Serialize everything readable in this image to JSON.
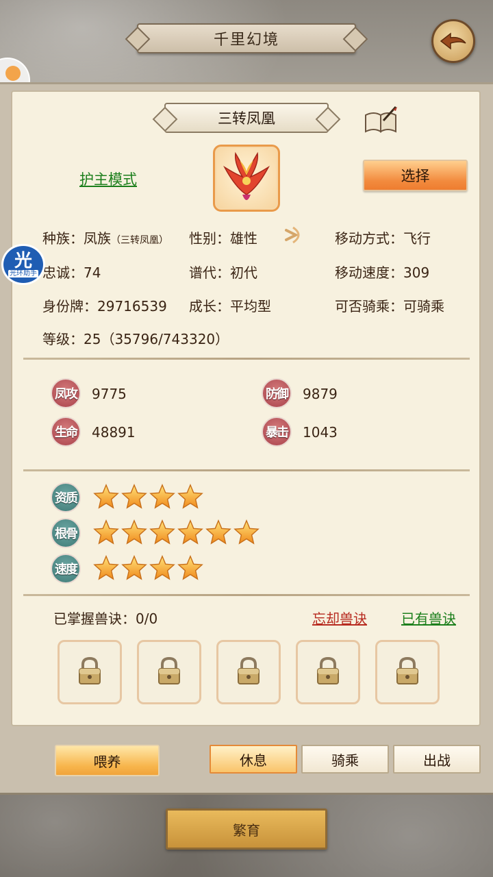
{
  "header": {
    "title": "千里幻境"
  },
  "helper": {
    "glyph": "光",
    "label": "光环助手"
  },
  "pet": {
    "name": "三转凤凰",
    "guard_mode_label": "护主模式",
    "select_label": "选择",
    "race": "种族：凤族",
    "race_detail": "（三转凤凰）",
    "gender": "性别：雄性",
    "movement_type": "移动方式：飞行",
    "loyalty": "忠诚：74",
    "generation": "谱代：初代",
    "movement_speed": "移动速度：309",
    "id_tag": "身份牌：29716539",
    "growth": "成长：平均型",
    "rideable": "可否骑乘：可骑乘",
    "level": "等级：25（35796/743320）"
  },
  "stats": {
    "attack": {
      "label": "凤攻",
      "value": "9775"
    },
    "defense": {
      "label": "防御",
      "value": "9879"
    },
    "hp": {
      "label": "生命",
      "value": "48891"
    },
    "crit": {
      "label": "暴击",
      "value": "1043"
    }
  },
  "ratings": {
    "aptitude": {
      "label": "资质",
      "stars": 4
    },
    "bone": {
      "label": "根骨",
      "stars": 6
    },
    "speed": {
      "label": "速度",
      "stars": 4
    }
  },
  "skills": {
    "mastered": "已掌握兽诀：0/0",
    "forget_label": "忘却兽诀",
    "owned_label": "已有兽诀",
    "slots": 5
  },
  "actions": {
    "feed": "喂养",
    "rest": "休息",
    "ride": "骑乘",
    "battle": "出战",
    "breed": "繁育"
  },
  "colors": {
    "link_green": "#1c7f1c",
    "link_red": "#b72a1f",
    "accent_orange": "#f28a3d",
    "star": "#f5a623"
  }
}
